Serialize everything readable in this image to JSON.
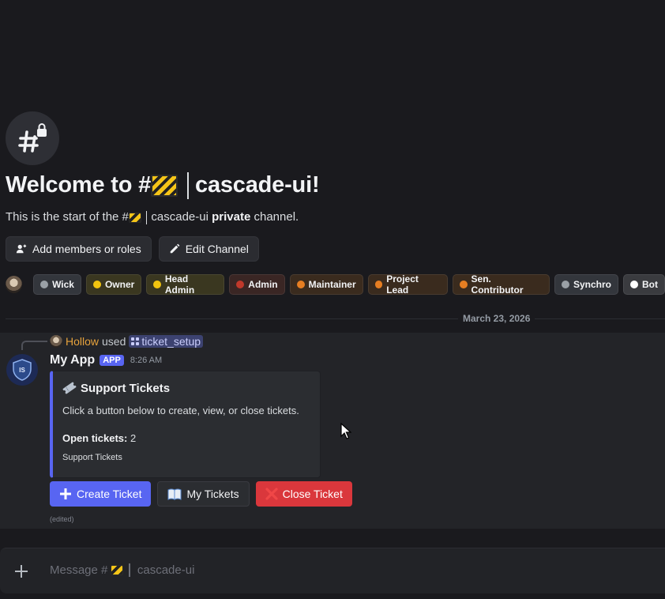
{
  "channel": {
    "icon": "hashtag-lock-icon",
    "welcome_prefix": "Welcome to #",
    "name": "cascade-ui",
    "welcome_suffix": "!",
    "sub_prefix": "This is the start of the #",
    "sub_name": "cascade-ui",
    "sub_private": "private",
    "sub_suffix": " channel."
  },
  "channel_actions": {
    "add_members": "Add members or roles",
    "edit_channel": "Edit Channel"
  },
  "roles": [
    {
      "label": "Wick",
      "dot": "#9aa0a6",
      "bg": "#33363c"
    },
    {
      "label": "Owner",
      "dot": "#f1c40f",
      "bg": "#3a3720"
    },
    {
      "label": "Head Admin",
      "dot": "#f1c40f",
      "bg": "#3a3720"
    },
    {
      "label": "Admin",
      "dot": "#c0392b",
      "bg": "#3a2624"
    },
    {
      "label": "Maintainer",
      "dot": "#e67e22",
      "bg": "#3a2b1e"
    },
    {
      "label": "Project Lead",
      "dot": "#e67e22",
      "bg": "#3a2b1e"
    },
    {
      "label": "Sen. Contributor",
      "dot": "#e67e22",
      "bg": "#3a2b1e"
    },
    {
      "label": "Synchro",
      "dot": "#9aa0a6",
      "bg": "#33363c"
    },
    {
      "label": "Bot",
      "dot": "#ffffff",
      "bg": "#3a3b3f"
    }
  ],
  "date_divider": "March 23, 2026",
  "message": {
    "reply_user": "Hollow",
    "reply_used": "used",
    "reply_command": "ticket_setup",
    "author": "My App",
    "app_tag": "APP",
    "time": "8:26 AM",
    "embed": {
      "title_icon": "ticket-icon",
      "title": "Support Tickets",
      "description": "Click a button below to create, view, or close tickets.",
      "field_name": "Open tickets:",
      "field_value": "2",
      "footer": "Support Tickets"
    },
    "buttons": {
      "create": "Create Ticket",
      "my": "My Tickets",
      "close": "Close Ticket"
    },
    "edited": "(edited)"
  },
  "composer": {
    "placeholder_prefix": "Message #",
    "placeholder_name": "cascade-ui"
  },
  "colors": {
    "accent": "#5865f2",
    "danger": "#da373c",
    "background": "#1a1a1e"
  }
}
